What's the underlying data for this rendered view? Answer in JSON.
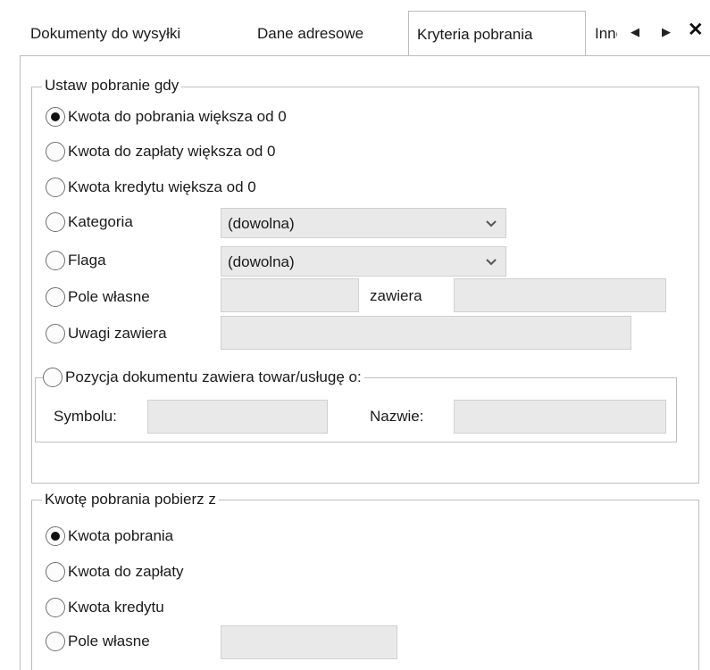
{
  "tabs": [
    {
      "label": "Dokumenty do wysyłki",
      "active": false
    },
    {
      "label": "Dane adresowe",
      "active": false
    },
    {
      "label": "Kryteria pobrania",
      "active": true
    },
    {
      "label": "Inne",
      "active": false
    }
  ],
  "tab_controls": {
    "scroll_left_icon": "◀",
    "scroll_right_icon": "▶",
    "close_icon": "✕"
  },
  "group1": {
    "legend": "Ustaw pobranie gdy",
    "options": [
      {
        "label": "Kwota do pobrania większa od 0",
        "checked": true
      },
      {
        "label": "Kwota do zapłaty większa od 0",
        "checked": false
      },
      {
        "label": "Kwota kredytu większa od 0",
        "checked": false
      },
      {
        "label": "Kategoria",
        "checked": false
      },
      {
        "label": "Flaga",
        "checked": false
      },
      {
        "label": "Pole własne",
        "checked": false
      },
      {
        "label": "Uwagi zawiera",
        "checked": false
      }
    ],
    "kategoria_value": "(dowolna)",
    "flaga_value": "(dowolna)",
    "pole_wlasne_value": "",
    "zawiera_label": "zawiera",
    "zawiera_value": "",
    "uwagi_value": "",
    "pozycja": {
      "label": "Pozycja dokumentu zawiera towar/usługę o:",
      "checked": false,
      "symbol_label": "Symbolu:",
      "symbol_value": "",
      "nazwa_label": "Nazwie:",
      "nazwa_value": ""
    }
  },
  "group2": {
    "legend": "Kwotę pobrania pobierz z",
    "options": [
      {
        "label": "Kwota pobrania",
        "checked": true
      },
      {
        "label": "Kwota do zapłaty",
        "checked": false
      },
      {
        "label": "Kwota kredytu",
        "checked": false
      },
      {
        "label": "Pole własne",
        "checked": false
      }
    ],
    "pole_wlasne_value": ""
  },
  "icons": {
    "dropdown": "chevron-down-icon"
  }
}
